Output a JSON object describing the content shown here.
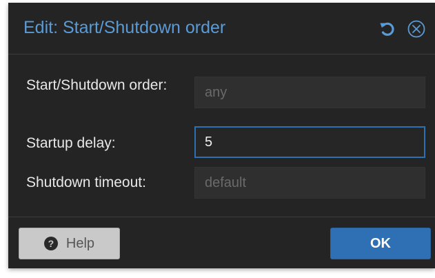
{
  "dialog": {
    "title": "Edit: Start/Shutdown order",
    "reset_icon": "undo-icon",
    "close_icon": "close-circle-icon",
    "accent_color": "#5b9bd5"
  },
  "form": {
    "order": {
      "label": "Start/Shutdown order:",
      "value": "",
      "placeholder": "any"
    },
    "startup_delay": {
      "label": "Startup delay:",
      "value": "5",
      "placeholder": ""
    },
    "shutdown_timeout": {
      "label": "Shutdown timeout:",
      "value": "",
      "placeholder": "default"
    }
  },
  "footer": {
    "help_label": "Help",
    "help_icon": "question-circle-icon",
    "ok_label": "OK",
    "ok_color": "#2f6fb3"
  }
}
